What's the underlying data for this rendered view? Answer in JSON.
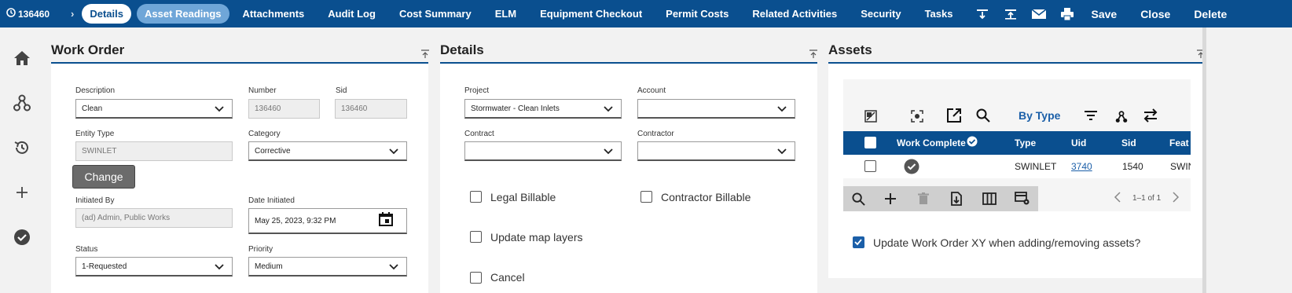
{
  "topbar": {
    "work_order_id": "136460",
    "tabs": [
      {
        "label": "Details",
        "state": "active"
      },
      {
        "label": "Asset Readings",
        "state": "secondary"
      },
      {
        "label": "Attachments"
      },
      {
        "label": "Audit Log"
      },
      {
        "label": "Cost Summary"
      },
      {
        "label": "ELM"
      },
      {
        "label": "Equipment Checkout"
      },
      {
        "label": "Permit Costs"
      },
      {
        "label": "Related Activities"
      },
      {
        "label": "Security"
      },
      {
        "label": "Tasks"
      }
    ],
    "icons": [
      "expand-all-icon",
      "collapse-all-icon",
      "mail-icon",
      "print-icon"
    ],
    "actions": {
      "save": "Save",
      "close": "Close",
      "delete": "Delete"
    }
  },
  "rail": {
    "icons": [
      "home-icon",
      "hierarchy-icon",
      "history-icon",
      "add-icon",
      "check-circle-icon"
    ]
  },
  "work_order": {
    "title": "Work Order",
    "description_label": "Description",
    "description_value": "Clean",
    "number_label": "Number",
    "number_value": "136460",
    "sid_label": "Sid",
    "sid_value": "136460",
    "entity_type_label": "Entity Type",
    "entity_type_value": "SWINLET",
    "category_label": "Category",
    "category_value": "Corrective",
    "change_button": "Change",
    "initiated_by_label": "Initiated By",
    "initiated_by_value": "(ad) Admin, Public Works",
    "date_initiated_label": "Date Initiated",
    "date_initiated_value": "May 25, 2023, 9:32 PM",
    "status_label": "Status",
    "status_value": "1-Requested",
    "priority_label": "Priority",
    "priority_value": "Medium"
  },
  "details": {
    "title": "Details",
    "project_label": "Project",
    "project_value": "Stormwater - Clean Inlets",
    "account_label": "Account",
    "account_value": "",
    "contract_label": "Contract",
    "contract_value": "",
    "contractor_label": "Contractor",
    "contractor_value": "",
    "legal_billable": "Legal Billable",
    "contractor_billable": "Contractor Billable",
    "update_map_layers": "Update map layers",
    "cancel": "Cancel"
  },
  "assets": {
    "title": "Assets",
    "by_type": "By Type",
    "columns": [
      "Work Complete",
      "Type",
      "Uid",
      "Sid",
      "Feat"
    ],
    "row": {
      "type": "SWINLET",
      "uid": "3740",
      "sid": "1540",
      "feat": "SWIN"
    },
    "pager": "1–1 of 1",
    "update_xy_label": "Update Work Order XY when adding/removing assets?"
  },
  "colors": {
    "brand": "#0a4f8f",
    "accent": "#1b5fa8"
  }
}
